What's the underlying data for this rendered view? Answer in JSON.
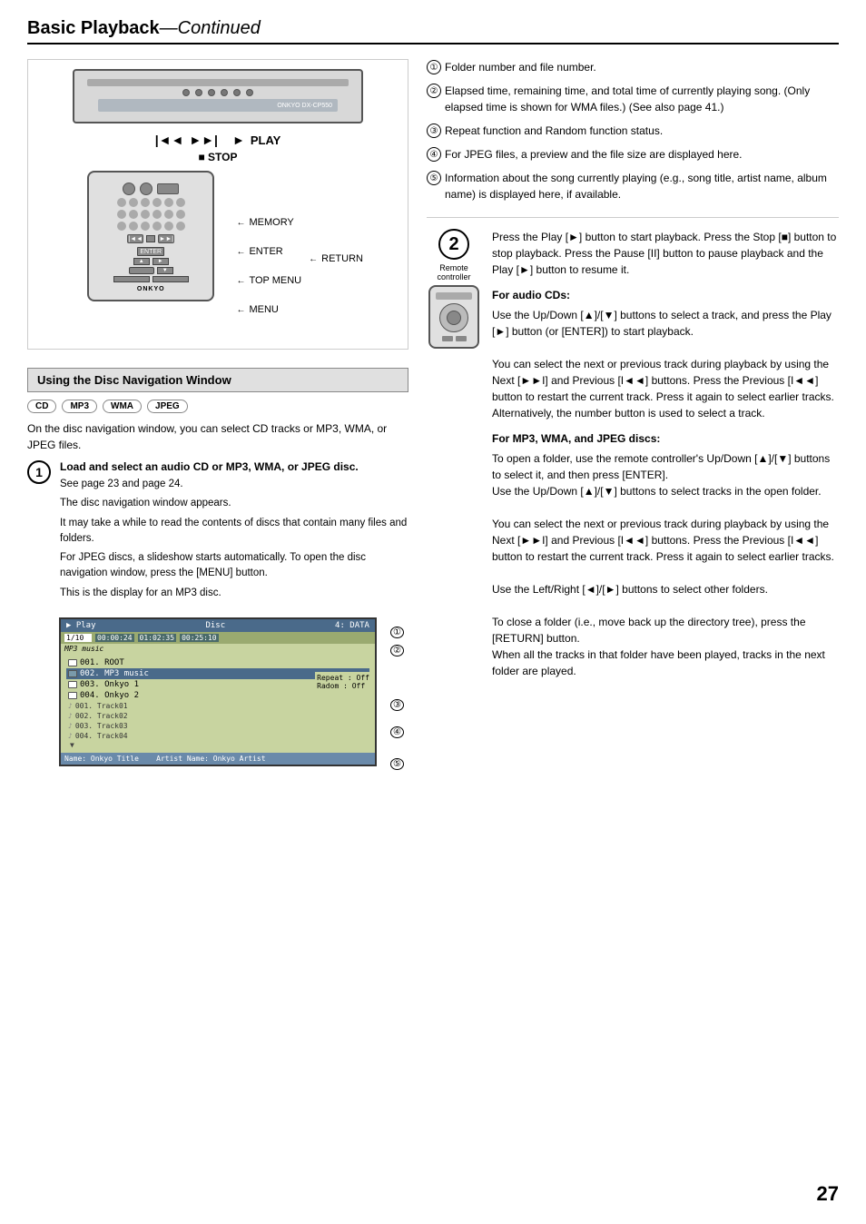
{
  "header": {
    "title": "Basic Playback",
    "subtitle": "—Continued"
  },
  "left_col": {
    "device_labels": {
      "play": "PLAY",
      "stop": "■ STOP",
      "memory": "MEMORY",
      "enter": "ENTER",
      "top_menu": "TOP MENU",
      "menu": "MENU",
      "return": "RETURN"
    },
    "nav_section": {
      "title": "Using the Disc Navigation Window",
      "formats": [
        "CD",
        "MP3",
        "WMA",
        "JPEG"
      ],
      "desc": "On the disc navigation window, you can select CD tracks or MP3, WMA, or JPEG files."
    },
    "step1": {
      "number": "1",
      "title": "Load and select an audio CD or MP3, WMA, or JPEG disc.",
      "lines": [
        "See page 23 and page 24.",
        "The disc navigation window appears.",
        "It may take a while to read the contents of discs that contain many files and folders.",
        "For JPEG discs, a slideshow starts automatically. To open the disc navigation window, press the [MENU] button.",
        "This is the display for an MP3 disc."
      ]
    },
    "display": {
      "header_left": "▶ Play",
      "header_disc": "Disc",
      "header_data": "4: DATA",
      "track_info": "1/10",
      "time1": "00:00:24",
      "time2": "01:02:35",
      "time3": "00:25:10",
      "mp3_label": "MP3 music",
      "folders": [
        {
          "name": "001. ROOT",
          "type": "root"
        },
        {
          "name": "002. MP3 music",
          "type": "folder",
          "selected": true
        },
        {
          "name": "003. Onkyo 1",
          "type": "folder"
        },
        {
          "name": "004. Onkyo 2",
          "type": "folder"
        },
        {
          "name": "001. Track01",
          "type": "track"
        },
        {
          "name": "002. Track02",
          "type": "track"
        },
        {
          "name": "003. Track03",
          "type": "track"
        },
        {
          "name": "004. Track04",
          "type": "track"
        }
      ],
      "right_panel": {
        "repeat_label": "Repeat",
        "repeat_value": ": Off",
        "random_label": "Radom",
        "random_value": ": Off"
      },
      "bottom": {
        "name_label": "Name: Onkyo Title",
        "artist_label": "Artist Name: Onkyo Artist"
      },
      "callouts": [
        "①",
        "②",
        "③",
        "④",
        "⑤"
      ]
    }
  },
  "right_col": {
    "numbered_items": [
      {
        "num": "1",
        "text": "Folder number and file number."
      },
      {
        "num": "2",
        "text": "Elapsed time, remaining time, and total time of currently playing song. (Only elapsed time is shown for WMA files.) (See also page 41.)"
      },
      {
        "num": "3",
        "text": "Repeat function and Random function status."
      },
      {
        "num": "4",
        "text": "For JPEG files, a preview and the file size are displayed here."
      },
      {
        "num": "5",
        "text": "Information about the song currently playing (e.g., song title, artist name, album name) is displayed here, if available."
      }
    ],
    "step2": {
      "number": "2",
      "remote_label": "Remote controller",
      "main_text": "Press the Play [►] button to start playback. Press the Stop [■] button to stop playback. Press the Pause [II] button to pause playback and the Play [►] button to resume it.",
      "audio_cd_heading": "For audio CDs:",
      "audio_cd_text": "Use the Up/Down [▲]/[▼] buttons to select a track, and press the Play [►] button (or [ENTER]) to start playback.\n\nYou can select the next or previous track during playback by using the Next [►►I] and Previous [I◄◄] buttons. Press the Previous [I◄◄] button to restart the current track. Press it again to select earlier tracks.\nAlternatively, the number button is used to select a track.",
      "mp3_heading": "For MP3, WMA, and JPEG discs:",
      "mp3_text": "To open a folder, use the remote controller's Up/Down [▲]/[▼] buttons to select it, and then press [ENTER].\nUse the Up/Down [▲]/[▼] buttons to select tracks in the open folder.\n\nYou can select the next or previous track during playback by using the Next [►►I] and Previous [I◄◄] buttons. Press the Previous [I◄◄] button to restart the current track. Press it again to select earlier tracks.\n\nUse the Left/Right [◄]/[►] buttons to select other folders.\n\nTo close a folder (i.e., move back up the directory tree), press the [RETURN] button.\nWhen all the tracks in that folder have been played, tracks in the next folder are played."
    }
  },
  "page_number": "27"
}
